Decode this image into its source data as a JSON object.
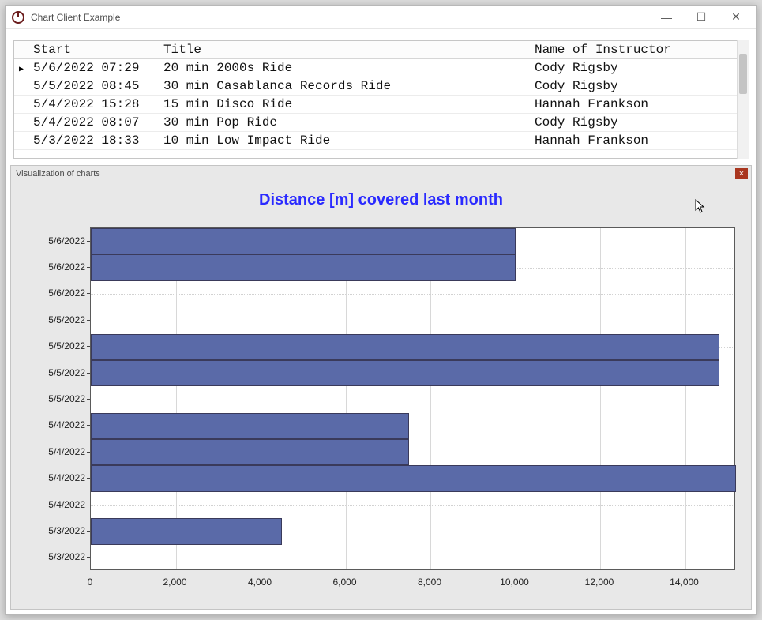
{
  "window": {
    "title": "Chart Client Example",
    "buttons": {
      "min": "—",
      "max": "☐",
      "close": "✕"
    }
  },
  "grid": {
    "headers": {
      "start": "Start",
      "title": "Title",
      "instructor": "Name of Instructor"
    },
    "rows": [
      {
        "start": "5/6/2022 07:29",
        "title": "20 min 2000s Ride",
        "instructor": "Cody Rigsby",
        "current": true
      },
      {
        "start": "5/5/2022 08:45",
        "title": "30 min Casablanca Records Ride",
        "instructor": "Cody Rigsby",
        "current": false
      },
      {
        "start": "5/4/2022 15:28",
        "title": "15 min Disco Ride",
        "instructor": "Hannah Frankson",
        "current": false
      },
      {
        "start": "5/4/2022 08:07",
        "title": "30 min Pop Ride",
        "instructor": "Cody Rigsby",
        "current": false
      },
      {
        "start": "5/3/2022 18:33",
        "title": "10 min Low Impact Ride",
        "instructor": "Hannah Frankson",
        "current": false
      }
    ]
  },
  "chart_panel": {
    "header": "Visualization of charts",
    "close": "×"
  },
  "chart_data": {
    "type": "bar",
    "orientation": "horizontal",
    "title": "Distance [m] covered last month",
    "xlabel": "",
    "ylabel": "",
    "xlim": [
      0,
      15200
    ],
    "x_ticks": [
      0,
      2000,
      4000,
      6000,
      8000,
      10000,
      12000,
      14000
    ],
    "x_tick_labels": [
      "0",
      "2,000",
      "4,000",
      "6,000",
      "8,000",
      "10,000",
      "12,000",
      "14,000"
    ],
    "categories": [
      "5/6/2022",
      "5/6/2022",
      "5/6/2022",
      "5/5/2022",
      "5/5/2022",
      "5/5/2022",
      "5/5/2022",
      "5/4/2022",
      "5/4/2022",
      "5/4/2022",
      "5/4/2022",
      "5/3/2022",
      "5/3/2022"
    ],
    "values": [
      10000,
      10000,
      0,
      0,
      14800,
      14800,
      0,
      7500,
      7500,
      15200,
      0,
      4500,
      0
    ],
    "bar_color": "#5a6aa8"
  }
}
